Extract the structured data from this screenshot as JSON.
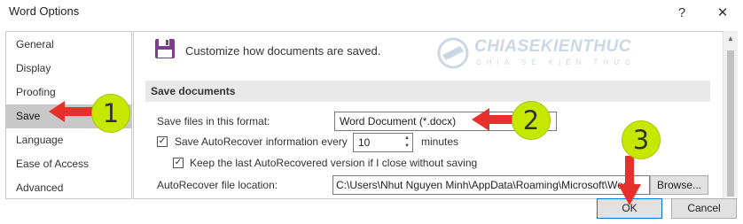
{
  "window": {
    "title": "Word Options",
    "help": "?",
    "close": "✕"
  },
  "sidebar": {
    "items": [
      {
        "label": "General"
      },
      {
        "label": "Display"
      },
      {
        "label": "Proofing"
      },
      {
        "label": "Save",
        "selected": true
      },
      {
        "label": "Language"
      },
      {
        "label": "Ease of Access"
      },
      {
        "label": "Advanced"
      }
    ]
  },
  "header": {
    "text": "Customize how documents are saved."
  },
  "watermark": {
    "brand": "CHIASEKIENTHUC",
    "tagline": "CHIA SẺ KIẾN THỨC"
  },
  "save_documents": {
    "section_title": "Save documents",
    "format_label": "Save files in this format:",
    "format_value": "Word Document (*.docx)",
    "autorecover_label": "Save AutoRecover information every",
    "autorecover_checked": true,
    "autorecover_minutes": "10",
    "minutes_label": "minutes",
    "keep_label": "Keep the last AutoRecovered version if I close without saving",
    "keep_checked": true,
    "location_label": "AutoRecover file location:",
    "location_value": "C:\\Users\\Nhut Nguyen Minh\\AppData\\Roaming\\Microsoft\\Word\\",
    "browse_label": "Browse..."
  },
  "footer": {
    "ok_label": "OK",
    "cancel_label": "Cancel"
  },
  "annotations": {
    "badge1": "1",
    "badge2": "2",
    "badge3": "3",
    "arrow_color": "#e8302a",
    "badge_color": "#c6e800"
  }
}
